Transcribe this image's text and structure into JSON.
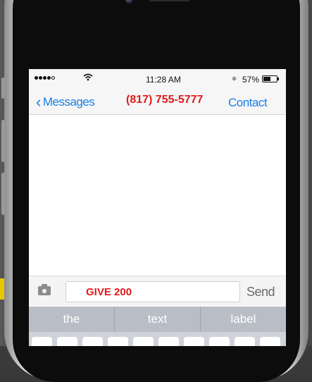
{
  "status_bar": {
    "time": "11:28 AM",
    "battery_percent": "57%",
    "signal_bars_filled": 4,
    "battery_level": 0.57
  },
  "nav": {
    "back_label": "Messages",
    "title": "(817) 755-5777",
    "contact_label": "Contact"
  },
  "composer": {
    "message_value": "GIVE 200",
    "send_label": "Send"
  },
  "suggestions": [
    "the",
    "text",
    "label"
  ],
  "colors": {
    "accent_blue": "#1a7fe5",
    "highlight_red": "#e01a1a",
    "suggestion_bar": "#b9bec6"
  },
  "icons": {
    "back": "chevron-left-icon",
    "camera": "camera-icon",
    "wifi": "wifi-icon",
    "bluetooth": "bluetooth-icon",
    "battery": "battery-icon"
  }
}
